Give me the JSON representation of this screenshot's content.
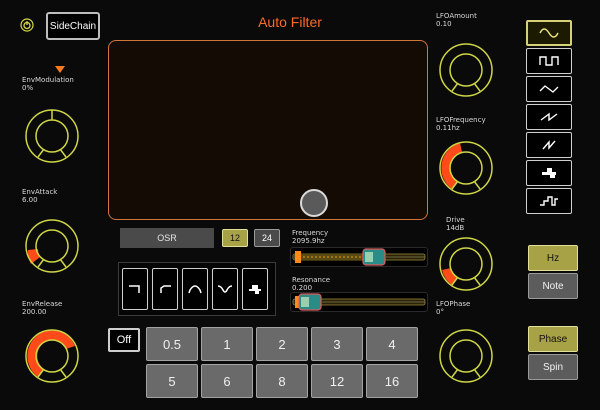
{
  "header": {
    "title": "Auto Filter",
    "sidechain_label": "SideChain"
  },
  "env": {
    "modulation": {
      "label": "EnvModulation",
      "value": "0%"
    },
    "attack": {
      "label": "EnvAttack",
      "value": "6.00"
    },
    "release": {
      "label": "EnvRelease",
      "value": "200.00"
    }
  },
  "lfo": {
    "amount": {
      "label": "LFOAmount",
      "value": "0.10"
    },
    "frequency": {
      "label": "LFOFrequency",
      "value": "0.11hz"
    },
    "phase": {
      "label": "LFOPhase",
      "value": "0°"
    }
  },
  "drive": {
    "label": "Drive",
    "value": "14dB"
  },
  "filter": {
    "osr_label": "OSR",
    "slope_12": "12",
    "slope_24": "24",
    "frequency": {
      "label": "Frequency",
      "value": "2095.9hz"
    },
    "resonance": {
      "label": "Resonance",
      "value": "0.200"
    }
  },
  "rate_mode": {
    "hz": "Hz",
    "note": "Note"
  },
  "phase_mode": {
    "phase": "Phase",
    "spin": "Spin"
  },
  "quantize": {
    "off_label": "Off",
    "beats": [
      "0.5",
      "1",
      "2",
      "3",
      "4",
      "5",
      "6",
      "8",
      "12",
      "16"
    ]
  },
  "colors": {
    "accent_orange": "#ff4a1a",
    "accent_yellow": "#d6d179",
    "title_orange": "#ff6a2a"
  }
}
